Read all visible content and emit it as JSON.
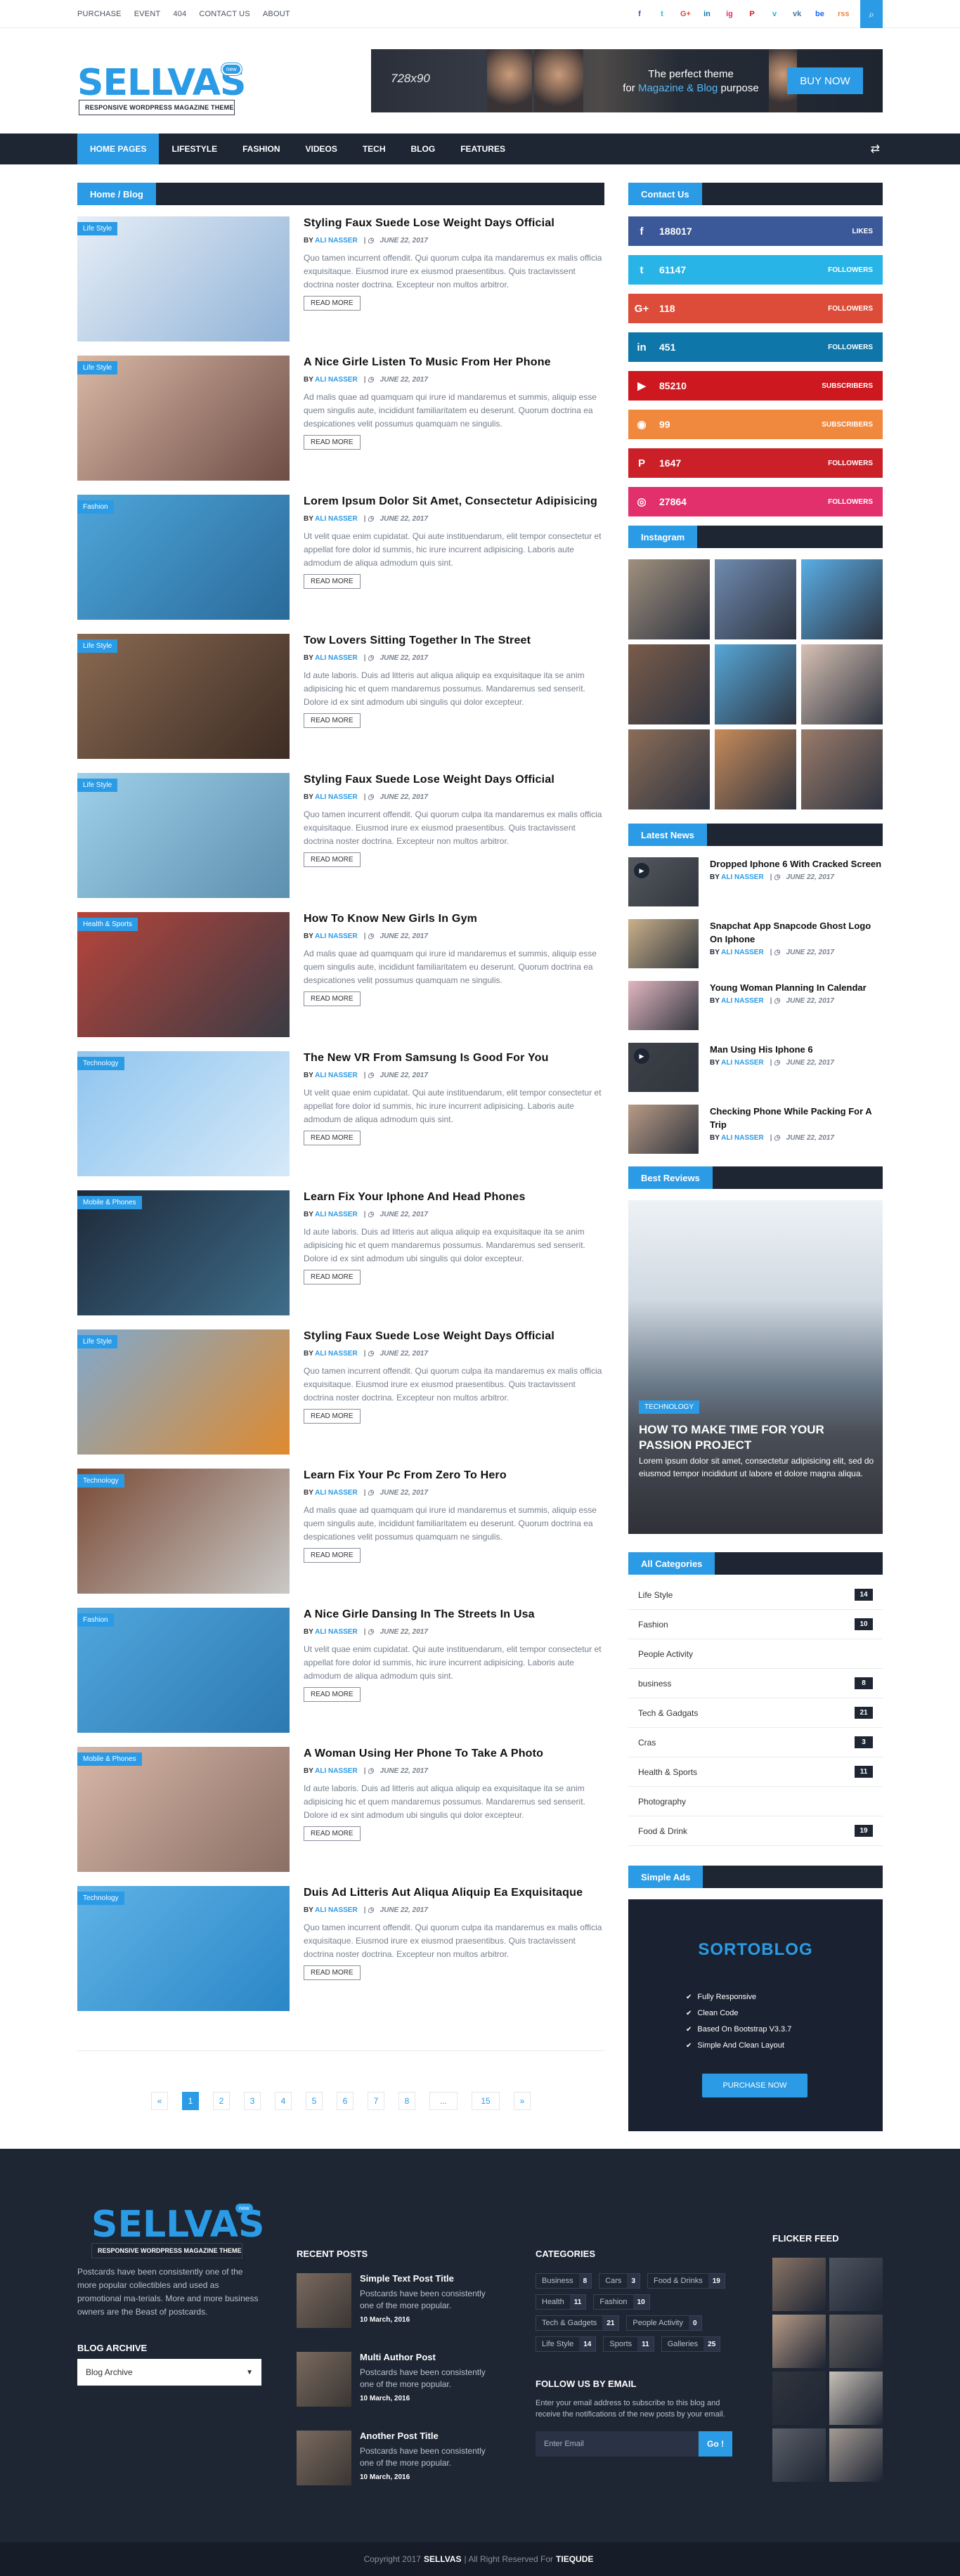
{
  "topbar": {
    "links": [
      "PURCHASE",
      "EVENT",
      "404",
      "CONTACT US",
      "ABOUT"
    ],
    "social": [
      "f",
      "t",
      "G+",
      "in",
      "ig",
      "P",
      "v",
      "vk",
      "be",
      "rss"
    ]
  },
  "logo": {
    "name": "SELLVAS",
    "tagline": "RESPONSIVE WORDPRESS MAGAZINE THEME",
    "badge": "new"
  },
  "ad": {
    "size": "728x90",
    "line1": "The perfect theme",
    "line2_pre": "for ",
    "line2_em": "Magazine & Blog",
    "line2_post": " purpose",
    "button": "BUY NOW"
  },
  "nav": {
    "items": [
      "HOME PAGES",
      "LIFESTYLE",
      "FASHION",
      "VIDEOS",
      "TECH",
      "BLOG",
      "FEATURES"
    ]
  },
  "breadcrumb": "Home / Blog",
  "posts": [
    {
      "cat": "Life Style",
      "title": "Styling Faux Suede Lose Weight Days Official",
      "author": "ALI NASSER",
      "date": "JUNE 22, 2017",
      "excerpt": "Quo tamen incurrent offendit. Qui quorum culpa ita mandaremus ex malis officia exquisitaque. Eiusmod irure ex eiusmod praesentibus. Quis tractavissent doctrina noster doctrina. Excepteur non multos arbitror.",
      "more": "READ MORE",
      "c1": "#e7eef7",
      "c2": "#8fb2d6"
    },
    {
      "cat": "Life Style",
      "title": "A Nice Girle Listen To Music From Her Phone",
      "author": "ALI NASSER",
      "date": "JUNE 22, 2017",
      "excerpt": "Ad malis quae ad quamquam qui irure id mandaremus et summis, aliquip esse quem singulis aute, incididunt familiaritatem eu deserunt. Quorum doctrina ea despicationes velit possumus quamquam ne singulis.",
      "more": "READ MORE",
      "c1": "#d9b8a6",
      "c2": "#6d4d45"
    },
    {
      "cat": "Fashion",
      "title": "Lorem Ipsum Dolor Sit Amet, Consectetur Adipisicing",
      "author": "ALI NASSER",
      "date": "JUNE 22, 2017",
      "excerpt": "Ut velit quae enim cupidatat. Qui aute instituendarum, elit tempor consectetur et appellat fore dolor id summis, hic irure incurrent adipisicing. Laboris aute admodum de aliqua admodum quis sint.",
      "more": "READ MORE",
      "c1": "#4ea6da",
      "c2": "#2a6a99"
    },
    {
      "cat": "Life Style",
      "title": "Tow Lovers Sitting Together In The Street",
      "author": "ALI NASSER",
      "date": "JUNE 22, 2017",
      "excerpt": "Id aute laboris. Duis ad litteris aut aliqua aliquip ea exquisitaque ita se anim adipisicing hic et quem mandaremus possumus. Mandaremus sed senserit. Dolore id ex sint admodum ubi singulis qui dolor excepteur.",
      "more": "READ MORE",
      "c1": "#8a6a52",
      "c2": "#3c2c24"
    },
    {
      "cat": "Life Style",
      "title": "Styling Faux Suede Lose Weight Days Official",
      "author": "ALI NASSER",
      "date": "JUNE 22, 2017",
      "excerpt": "Quo tamen incurrent offendit. Qui quorum culpa ita mandaremus ex malis officia exquisitaque. Eiusmod irure ex eiusmod praesentibus. Quis tractavissent doctrina noster doctrina. Excepteur non multos arbitror.",
      "more": "READ MORE",
      "c1": "#9fd0ea",
      "c2": "#5d8fae"
    },
    {
      "cat": "Health & Sports",
      "title": "How To Know New Girls In Gym",
      "author": "ALI NASSER",
      "date": "JUNE 22, 2017",
      "excerpt": "Ad malis quae ad quamquam qui irure id mandaremus et summis, aliquip esse quem singulis aute, incididunt familiaritatem eu deserunt. Quorum doctrina ea despicationes velit possumus quamquam ne singulis.",
      "more": "READ MORE",
      "c1": "#b7443a",
      "c2": "#3a3c45"
    },
    {
      "cat": "Technology",
      "title": "The New VR From Samsung Is Good For You",
      "author": "ALI NASSER",
      "date": "JUNE 22, 2017",
      "excerpt": "Ut velit quae enim cupidatat. Qui aute instituendarum, elit tempor consectetur et appellat fore dolor id summis, hic irure incurrent adipisicing. Laboris aute admodum de aliqua admodum quis sint.",
      "more": "READ MORE",
      "c1": "#8fc5ef",
      "c2": "#d6e9f8"
    },
    {
      "cat": "Mobile & Phones",
      "title": "Learn Fix Your Iphone And Head Phones",
      "author": "ALI NASSER",
      "date": "JUNE 22, 2017",
      "excerpt": "Id aute laboris. Duis ad litteris aut aliqua aliquip ea exquisitaque ita se anim adipisicing hic et quem mandaremus possumus. Mandaremus sed senserit. Dolore id ex sint admodum ubi singulis qui dolor excepteur.",
      "more": "READ MORE",
      "c1": "#1e2a3a",
      "c2": "#3e6d8a"
    },
    {
      "cat": "Life Style",
      "title": "Styling Faux Suede Lose Weight Days Official",
      "author": "ALI NASSER",
      "date": "JUNE 22, 2017",
      "excerpt": "Quo tamen incurrent offendit. Qui quorum culpa ita mandaremus ex malis officia exquisitaque. Eiusmod irure ex eiusmod praesentibus. Quis tractavissent doctrina noster doctrina. Excepteur non multos arbitror.",
      "more": "READ MORE",
      "c1": "#7fa9cf",
      "c2": "#e08a2e"
    },
    {
      "cat": "Technology",
      "title": "Learn Fix Your Pc From Zero To Hero",
      "author": "ALI NASSER",
      "date": "JUNE 22, 2017",
      "excerpt": "Ad malis quae ad quamquam qui irure id mandaremus et summis, aliquip esse quem singulis aute, incididunt familiaritatem eu deserunt. Quorum doctrina ea despicationes velit possumus quamquam ne singulis.",
      "more": "READ MORE",
      "c1": "#7a4a36",
      "c2": "#c9c9c6"
    },
    {
      "cat": "Fashion",
      "title": "A Nice Girle Dansing In The Streets In Usa",
      "author": "ALI NASSER",
      "date": "JUNE 22, 2017",
      "excerpt": "Ut velit quae enim cupidatat. Qui aute instituendarum, elit tempor consectetur et appellat fore dolor id summis, hic irure incurrent adipisicing. Laboris aute admodum de aliqua admodum quis sint.",
      "more": "READ MORE",
      "c1": "#4fa7dd",
      "c2": "#2d78b0"
    },
    {
      "cat": "Mobile & Phones",
      "title": "A Woman Using Her Phone To Take A Photo",
      "author": "ALI NASSER",
      "date": "JUNE 22, 2017",
      "excerpt": "Id aute laboris. Duis ad litteris aut aliqua aliquip ea exquisitaque ita se anim adipisicing hic et quem mandaremus possumus. Mandaremus sed senserit. Dolore id ex sint admodum ubi singulis qui dolor excepteur.",
      "more": "READ MORE",
      "c1": "#d7b7a8",
      "c2": "#8a6f64"
    },
    {
      "cat": "Technology",
      "title": "Duis Ad Litteris Aut Aliqua Aliquip Ea Exquisitaque",
      "author": "ALI NASSER",
      "date": "JUNE 22, 2017",
      "excerpt": "Quo tamen incurrent offendit. Qui quorum culpa ita mandaremus ex malis officia exquisitaque. Eiusmod irure ex eiusmod praesentibus. Quis tractavissent doctrina noster doctrina. Excepteur non multos arbitror.",
      "more": "READ MORE",
      "c1": "#5fb3e6",
      "c2": "#2b86c6"
    }
  ],
  "pagination": [
    "«",
    "1",
    "2",
    "3",
    "4",
    "5",
    "6",
    "7",
    "8",
    "...",
    "15",
    "»"
  ],
  "sidebar": {
    "contact_title": "Contact Us",
    "social": [
      {
        "icon": "f",
        "count": "188017",
        "label": "LIKES",
        "color": "#3b5998"
      },
      {
        "icon": "t",
        "count": "61147",
        "label": "FOLLOWERS",
        "color": "#29b4e8"
      },
      {
        "icon": "G+",
        "count": "118",
        "label": "FOLLOWERS",
        "color": "#dd4b39"
      },
      {
        "icon": "in",
        "count": "451",
        "label": "FOLLOWERS",
        "color": "#0e76a8"
      },
      {
        "icon": "▶",
        "count": "85210",
        "label": "SUBSCRIBERS",
        "color": "#cc181e"
      },
      {
        "icon": "◉",
        "count": "99",
        "label": "SUBSCRIBERS",
        "color": "#f0883e"
      },
      {
        "icon": "P",
        "count": "1647",
        "label": "FOLLOWERS",
        "color": "#cb2027"
      },
      {
        "icon": "◎",
        "count": "27864",
        "label": "FOLLOWERS",
        "color": "#e1306c"
      }
    ],
    "instagram_title": "Instagram",
    "instagram": [
      "#a0907e",
      "#6f8bb0",
      "#5aaee6",
      "#7a5c4a",
      "#56a7d8",
      "#d8c1b4",
      "#8c6d58",
      "#c88b5a",
      "#9a7b6a"
    ],
    "news_title": "Latest News",
    "news": [
      {
        "title": "Dropped Iphone 6 With Cracked Screen",
        "author": "ALI NASSER",
        "date": "JUNE 22, 2017",
        "play": true,
        "c": "#55595f"
      },
      {
        "title": "Snapchat App Snapcode Ghost Logo On Iphone",
        "author": "ALI NASSER",
        "date": "JUNE 22, 2017",
        "play": false,
        "c": "#c9b08a"
      },
      {
        "title": "Young Woman Planning In Calendar",
        "author": "ALI NASSER",
        "date": "JUNE 22, 2017",
        "play": false,
        "c": "#e2b6c0"
      },
      {
        "title": "Man Using His Iphone 6",
        "author": "ALI NASSER",
        "date": "JUNE 22, 2017",
        "play": true,
        "c": "#3e4148"
      },
      {
        "title": "Checking Phone While Packing For A Trip",
        "author": "ALI NASSER",
        "date": "JUNE 22, 2017",
        "play": false,
        "c": "#b89b86"
      }
    ],
    "reviews_title": "Best Reviews",
    "review": {
      "cat": "TECHNOLOGY",
      "title": "HOW TO MAKE TIME FOR YOUR PASSION PROJECT",
      "text": "Lorem ipsum dolor sit amet, consectetur adipisicing elit, sed do eiusmod tempor incididunt ut labore et dolore magna aliqua."
    },
    "categories_title": "All Categories",
    "categories": [
      {
        "name": "Life Style",
        "n": "14"
      },
      {
        "name": "Fashion",
        "n": "10"
      },
      {
        "name": "People Activity",
        "n": ""
      },
      {
        "name": "business",
        "n": "8"
      },
      {
        "name": "Tech & Gadgats",
        "n": "21"
      },
      {
        "name": "Cras",
        "n": "3"
      },
      {
        "name": "Health & Sports",
        "n": "11"
      },
      {
        "name": "Photography",
        "n": ""
      },
      {
        "name": "Food & Drink",
        "n": "19"
      }
    ],
    "ads_title": "Simple Ads",
    "ad": {
      "title": "SORTOBLOG",
      "features": [
        "Fully Responsive",
        "Clean Code",
        "Based On Bootstrap V3.3.7",
        "Simple And Clean Layout"
      ],
      "button": "PURCHASE NOW"
    }
  },
  "footer": {
    "about": "Postcards have been consistently one of the more popular collectibles and used as promotional ma-terials. More and more business owners are the Beast of postcards.",
    "archive_title": "BLOG ARCHIVE",
    "archive_value": "Blog Archive",
    "recent_title": "RECENT POSTS",
    "recent": [
      {
        "title": "Simple Text Post Title",
        "text": "Postcards have been consistently one of the more popular.",
        "date": "10 March, 2016"
      },
      {
        "title": "Multi Author Post",
        "text": "Postcards have been consistently one of the more popular.",
        "date": "10 March, 2016"
      },
      {
        "title": "Another Post Title",
        "text": "Postcards have been consistently one of the more popular.",
        "date": "10 March, 2016"
      }
    ],
    "categories_title": "CATEGORIES",
    "tags": [
      {
        "name": "Business",
        "n": "8"
      },
      {
        "name": "Cars",
        "n": "3"
      },
      {
        "name": "Food & Drinks",
        "n": "19"
      },
      {
        "name": "Health",
        "n": "11"
      },
      {
        "name": "Fashion",
        "n": "10"
      },
      {
        "name": "Tech & Gadgets",
        "n": "21"
      },
      {
        "name": "People Activity",
        "n": "0"
      },
      {
        "name": "Life Style",
        "n": "14"
      },
      {
        "name": "Sports",
        "n": "11"
      },
      {
        "name": "Galleries",
        "n": "25"
      }
    ],
    "follow_title": "FOLLOW US BY EMAIL",
    "follow_text": "Enter your email address to subscribe to this blog and receive the notifications of the new posts by your email.",
    "email_placeholder": "Enter Email",
    "go": "Go !",
    "flickr_title": "FLICKER FEED",
    "flickr": [
      "#8a7566",
      "#4e555f",
      "#b89c87",
      "#6a6562",
      "#30353d",
      "#c9c1b8",
      "#5b6068",
      "#a49b94"
    ],
    "copyright_pre": "Copyright 2017",
    "copyright_brand": "SELLVAS",
    "copyright_mid": "| All Right Reserved For",
    "copyright_owner": "TIEQUDE"
  }
}
